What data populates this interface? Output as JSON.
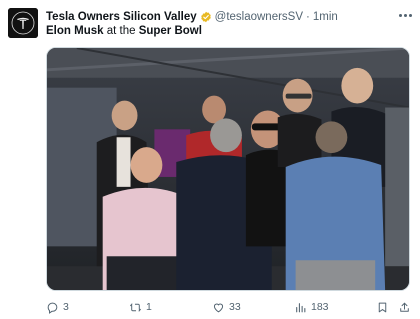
{
  "author": {
    "display_name": "Tesla Owners Silicon Valley",
    "handle": "@teslaownersSV",
    "separator": "·",
    "time": "1min",
    "verified_color": "#e8b923"
  },
  "tweet": {
    "text_bold_1": "Elon Musk",
    "text_plain": " at the ",
    "text_bold_2": "Super Bowl"
  },
  "media": {
    "description_icon": "photo"
  },
  "actions": {
    "replies": "3",
    "retweets": "1",
    "likes": "33",
    "views": "183"
  },
  "colors": {
    "text": "#0f1419",
    "muted": "#536471",
    "border": "#cfd9de"
  }
}
